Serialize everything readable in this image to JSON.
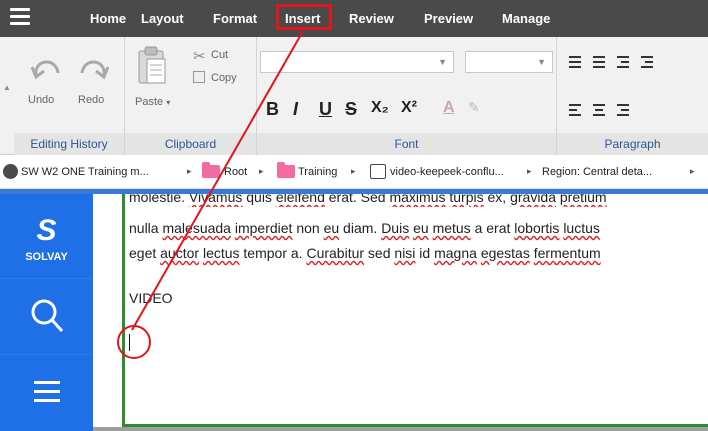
{
  "menu": {
    "items": [
      "Home",
      "Layout",
      "Format",
      "Insert",
      "Review",
      "Preview",
      "Manage"
    ]
  },
  "ribbon": {
    "editing_history": {
      "label": "Editing History",
      "undo": "Undo",
      "redo": "Redo"
    },
    "clipboard": {
      "label": "Clipboard",
      "paste": "Paste",
      "cut": "Cut",
      "copy": "Copy"
    },
    "font": {
      "label": "Font",
      "bold": "B",
      "italic": "I",
      "underline": "U",
      "strike": "S",
      "subscript": "X₂",
      "superscript": "X²",
      "font_color": "A"
    },
    "paragraph": {
      "label": "Paragraph"
    }
  },
  "breadcrumb": {
    "items": [
      "SW W2 ONE Training m...",
      "Root",
      "Training",
      "video-keepeek-conflu...",
      "Region: Central deta..."
    ]
  },
  "sidebar": {
    "logo_letter": "S",
    "logo_text": "SOLVAY"
  },
  "editor": {
    "line1_parts": [
      "molestie. ",
      "Vivamus",
      " quis ",
      "eleifend",
      " erat. Sed ",
      "maximus",
      " ",
      "turpis",
      " ex, ",
      "gravida",
      " ",
      "pretium"
    ],
    "line2_parts": [
      "nulla ",
      "malesuada",
      " ",
      "imperdiet",
      " non ",
      "eu",
      " diam. ",
      "Duis",
      " ",
      "eu",
      " ",
      "metus",
      " a erat ",
      "lobortis",
      " ",
      "luctus"
    ],
    "line3_parts": [
      "eget ",
      "auctor",
      " ",
      "lectus",
      " tempor a. ",
      "Curabitur",
      " sed ",
      "nisi",
      " id ",
      "magna",
      " ",
      "egestas",
      " ",
      "fermentum"
    ],
    "video_label": "VIDEO"
  },
  "colors": {
    "menubar": "#4a4a4a",
    "sidebar": "#1f6fe6",
    "annotation": "#e0161a",
    "frame": "#2e8b2e"
  }
}
